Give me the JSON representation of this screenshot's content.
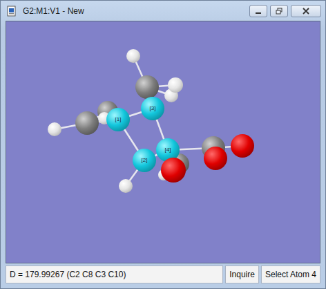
{
  "window": {
    "title": "G2:M1:V1 - New"
  },
  "atoms": [
    {
      "kind": "hydrogen",
      "selected": false
    },
    {
      "kind": "carbon",
      "selected": false
    },
    {
      "kind": "hydrogen",
      "selected": false
    },
    {
      "kind": "carbon",
      "selected": false
    },
    {
      "kind": "hydrogen",
      "selected": false
    },
    {
      "kind": "hydrogen",
      "selected": false
    },
    {
      "kind": "carbon",
      "selected": false
    },
    {
      "kind": "carbon",
      "selected": false
    },
    {
      "kind": "hydrogen",
      "selected": false
    },
    {
      "kind": "hydrogen",
      "selected": false
    },
    {
      "kind": "carbon",
      "selected": true,
      "label": "[3]"
    },
    {
      "kind": "carbon",
      "selected": true,
      "label": "[1]"
    },
    {
      "kind": "carbon",
      "selected": false
    },
    {
      "kind": "oxygen",
      "selected": false
    },
    {
      "kind": "oxygen",
      "selected": false
    },
    {
      "kind": "carbon",
      "selected": true,
      "label": "[4]"
    },
    {
      "kind": "carbon",
      "selected": true,
      "label": "[2]"
    },
    {
      "kind": "hydrogen",
      "selected": false
    },
    {
      "kind": "oxygen",
      "selected": false
    }
  ],
  "status_bar": {
    "measurement": "D = 179.99267 (C2 C8 C3 C10)",
    "mode": "Inquire",
    "prompt": "Select Atom 4"
  }
}
